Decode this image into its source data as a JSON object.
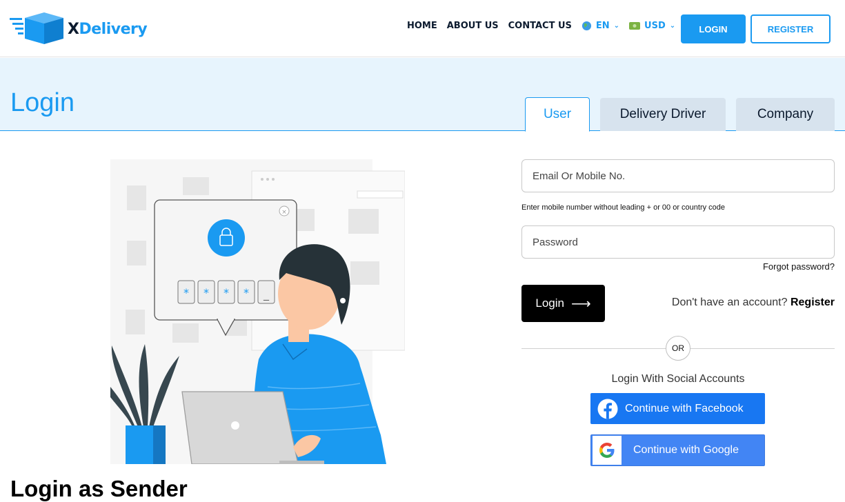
{
  "header": {
    "logo_text_prefix": "X",
    "logo_text_suffix": "Delivery",
    "nav": [
      "HOME",
      "ABOUT US",
      "CONTACT US"
    ],
    "language": "EN",
    "currency": "USD",
    "login_label": "LOGIN",
    "register_label": "REGISTER"
  },
  "page": {
    "title": "Login",
    "tabs": [
      "User",
      "Delivery Driver",
      "Company"
    ],
    "active_tab": "User",
    "section_heading": "Login as Sender"
  },
  "form": {
    "email_placeholder": "Email Or Mobile No.",
    "email_hint": "Enter mobile number without leading + or 00 or country code",
    "password_placeholder": "Password",
    "forgot_label": "Forgot password?",
    "login_button": "Login",
    "no_account_text": "Don't have an account?",
    "register_link": "Register",
    "or_label": "OR",
    "social_title": "Login With Social Accounts",
    "facebook_label": "Continue with Facebook",
    "google_label": "Continue with Google"
  },
  "colors": {
    "accent": "#1a9af1",
    "band": "#e7f4fd",
    "facebook": "#1877f2",
    "google": "#4285f4"
  },
  "icons": [
    "logo-box-icon",
    "globe-icon",
    "money-icon",
    "chevron-down-icon",
    "arrow-right-icon",
    "facebook-icon",
    "google-icon",
    "lock-icon"
  ]
}
